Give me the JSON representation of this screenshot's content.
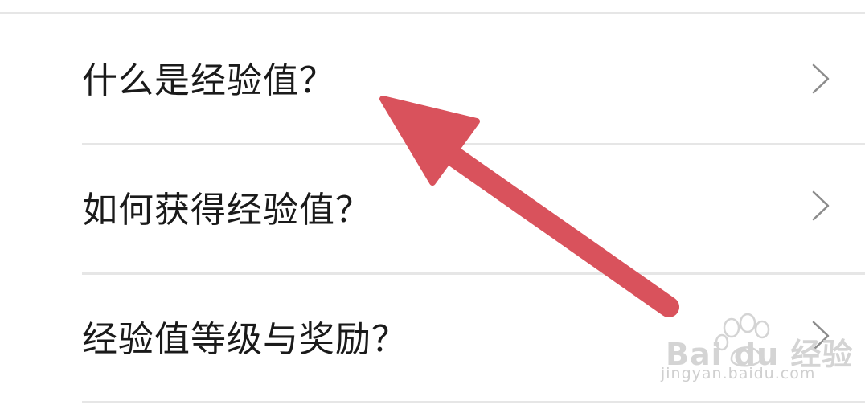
{
  "list": {
    "items": [
      {
        "label": "什么是经验值？",
        "icon": "chevron-right-icon"
      },
      {
        "label": "如何获得经验值？",
        "icon": "chevron-right-icon"
      },
      {
        "label": "经验值等级与奖励？",
        "icon": "chevron-right-icon"
      }
    ]
  },
  "overlay": {
    "arrow_color": "#d9525c"
  },
  "watermark": {
    "brand": "Bai du 经验",
    "url": "jingyan.baidu.com"
  },
  "colors": {
    "text": "#1a1a1a",
    "divider": "#e6e6e6",
    "chevron": "#8c8c8c",
    "watermark": "#d4d4d4"
  }
}
